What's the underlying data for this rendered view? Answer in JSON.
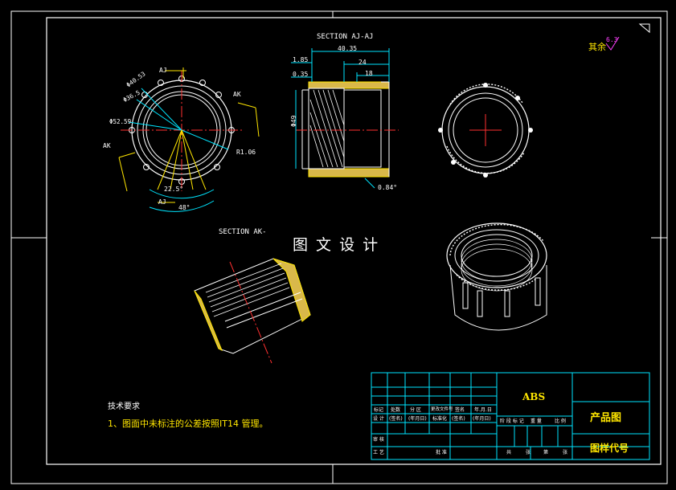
{
  "drawing": {
    "section_aj_title": "SECTION AJ-AJ",
    "section_ak_title": "SECTION AK-",
    "watermark": "图 文 设 计",
    "roughness_label": "其余",
    "roughness_value": "6.3"
  },
  "dimensions": {
    "d_40_35": "40.35",
    "d_24": "24",
    "d_18": "18",
    "d_1_85": "1.85",
    "d_0_35": "0.35",
    "d_phi49": "Φ49",
    "d_0_84": "0.84°",
    "d_phi40_53": "Φ40.53",
    "d_phi36_5": "Φ36.5",
    "d_phi52_59": "Φ52.59",
    "r1_06": "R1.06",
    "ang_22_5": "22.5°",
    "ang_48": "48°",
    "label_aj_top": "AJ",
    "label_aj_bottom": "AJ",
    "label_ak_left": "AK",
    "label_ak_right": "AK"
  },
  "tech_notes": {
    "heading": "技术要求",
    "item1": "1、图面中未标注的公差按照IT14 管理。"
  },
  "title_block": {
    "material": "ABS",
    "drawing_name": "产品图",
    "drawing_code": "图样代号",
    "row1": [
      "标记",
      "处数",
      "分 区",
      "更改文件号",
      "签名",
      "年.月.日"
    ],
    "row2": [
      "设 计",
      "(签名)",
      "(年月日)",
      "标准化",
      "(签名)",
      "(年月日)"
    ],
    "stage_headers": [
      "阶 段 标 记",
      "重 量",
      "比 例"
    ],
    "row_review": "审 核",
    "row_process": "工 艺",
    "row_approve": "批 准",
    "sheet_info": [
      "共",
      "张",
      "第",
      "张"
    ]
  }
}
